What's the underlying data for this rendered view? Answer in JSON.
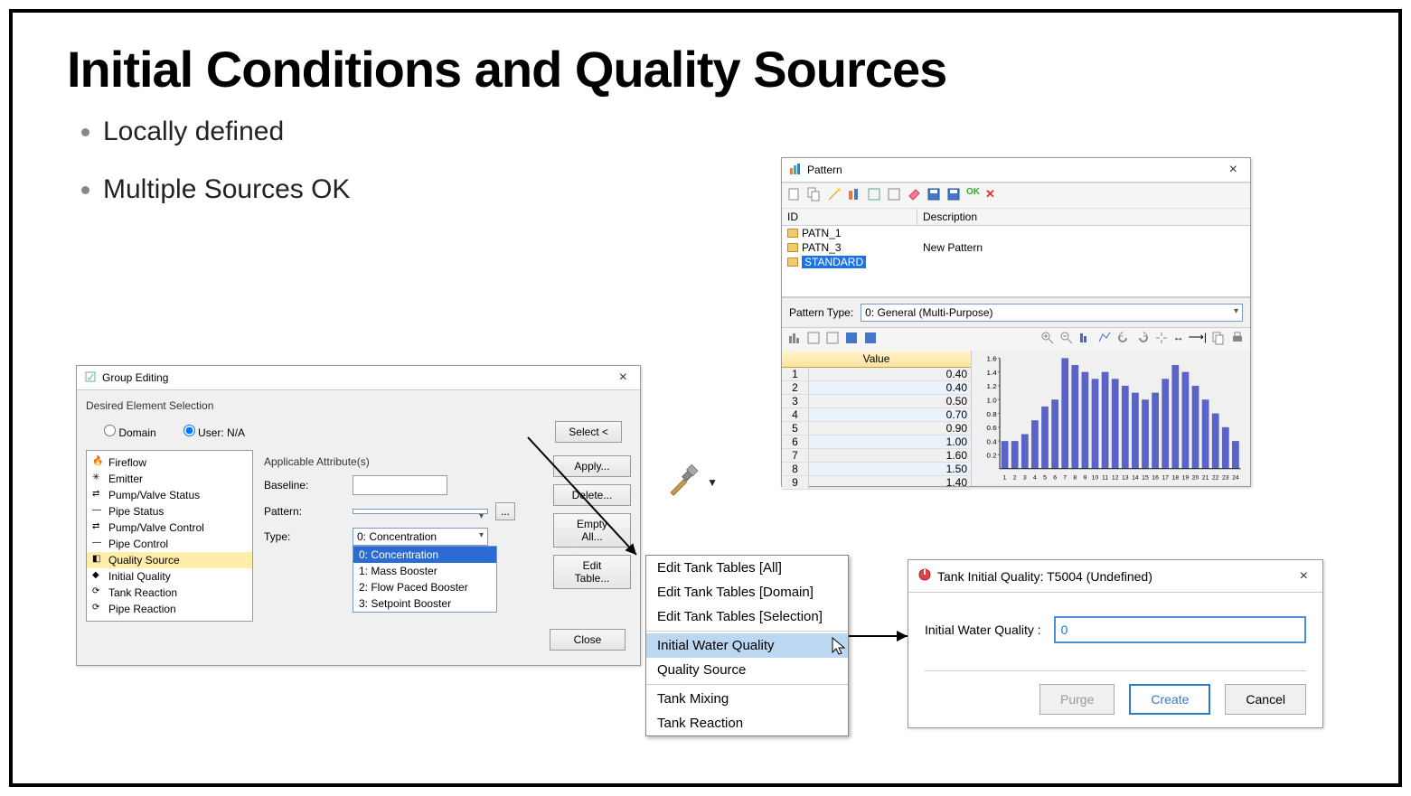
{
  "slide": {
    "title": "Initial Conditions and Quality Sources",
    "bullets": [
      "Locally defined",
      "Multiple Sources OK"
    ]
  },
  "group_edit": {
    "title": "Group Editing",
    "desired_label": "Desired Element Selection",
    "radio_domain": "Domain",
    "radio_user": "User: N/A",
    "select_btn": "Select <",
    "applicable_label": "Applicable Attribute(s)",
    "baseline_label": "Baseline:",
    "pattern_label": "Pattern:",
    "type_label": "Type:",
    "type_selected": "0: Concentration",
    "type_options": [
      "0: Concentration",
      "1: Mass Booster",
      "2: Flow Paced Booster",
      "3: Setpoint Booster"
    ],
    "tree": [
      "Fireflow",
      "Emitter",
      "Pump/Valve Status",
      "Pipe Status",
      "Pump/Valve Control",
      "Pipe Control",
      "Quality Source",
      "Initial Quality",
      "Tank Reaction",
      "Pipe Reaction"
    ],
    "tree_selected_index": 6,
    "btns": {
      "apply": "Apply...",
      "delete": "Delete...",
      "empty": "Empty All...",
      "edit": "Edit Table...",
      "close": "Close"
    }
  },
  "pattern_dlg": {
    "title": "Pattern",
    "cols": {
      "id": "ID",
      "desc": "Description"
    },
    "rows": [
      {
        "id": "PATN_1",
        "desc": ""
      },
      {
        "id": "PATN_3",
        "desc": "New Pattern"
      },
      {
        "id": "STANDARD",
        "desc": ""
      }
    ],
    "selected_index": 2,
    "type_label": "Pattern Type:",
    "type_value": "0: General (Multi-Purpose)",
    "value_header": "Value",
    "values": [
      {
        "n": 1,
        "v": "0.40"
      },
      {
        "n": 2,
        "v": "0.40"
      },
      {
        "n": 3,
        "v": "0.50"
      },
      {
        "n": 4,
        "v": "0.70"
      },
      {
        "n": 5,
        "v": "0.90"
      },
      {
        "n": 6,
        "v": "1.00"
      },
      {
        "n": 7,
        "v": "1.60"
      },
      {
        "n": 8,
        "v": "1.50"
      },
      {
        "n": 9,
        "v": "1.40"
      }
    ]
  },
  "context_menu": {
    "items": [
      "Edit Tank Tables [All]",
      "Edit Tank Tables [Domain]",
      "Edit Tank Tables [Selection]",
      "-",
      "Initial Water Quality",
      "Quality Source",
      "-",
      "Tank Mixing",
      "Tank Reaction"
    ],
    "selected": "Initial Water Quality"
  },
  "tank_dlg": {
    "title": "Tank Initial Quality: T5004 (Undefined)",
    "label": "Initial Water Quality :",
    "value": "0",
    "purge": "Purge",
    "create": "Create",
    "cancel": "Cancel"
  },
  "chart_data": {
    "type": "bar",
    "categories": [
      1,
      2,
      3,
      4,
      5,
      6,
      7,
      8,
      9,
      10,
      11,
      12,
      13,
      14,
      15,
      16,
      17,
      18,
      19,
      20,
      21,
      22,
      23,
      24
    ],
    "values": [
      0.4,
      0.4,
      0.5,
      0.7,
      0.9,
      1.0,
      1.6,
      1.5,
      1.4,
      1.3,
      1.4,
      1.3,
      1.2,
      1.1,
      1.0,
      1.1,
      1.3,
      1.5,
      1.4,
      1.2,
      1.0,
      0.8,
      0.6,
      0.4
    ],
    "ylim": [
      0,
      1.6
    ],
    "yticks": [
      0.2,
      0.4,
      0.6,
      0.8,
      1.0,
      1.2,
      1.4,
      1.6
    ],
    "xlabel": "",
    "ylabel": "",
    "title": ""
  }
}
